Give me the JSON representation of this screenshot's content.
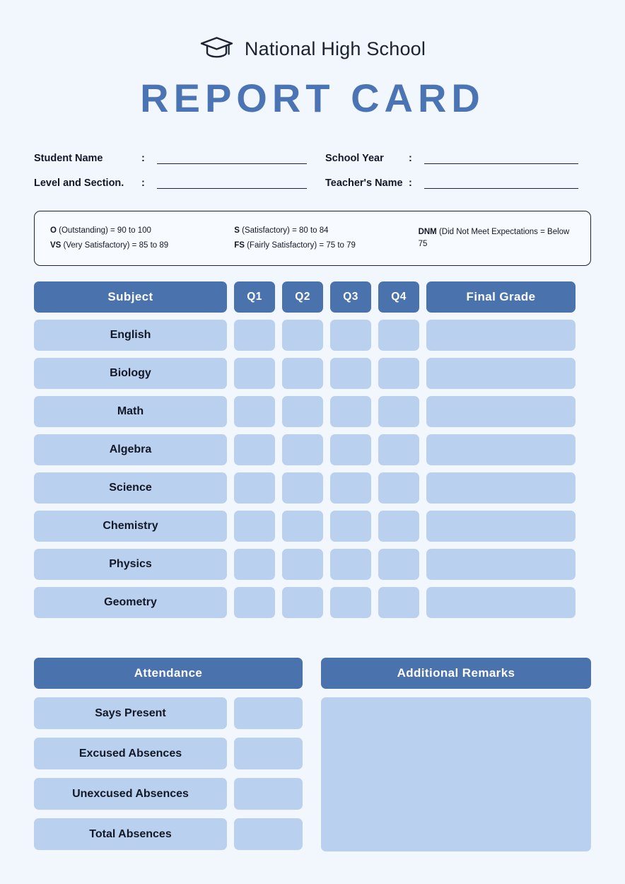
{
  "header": {
    "school_name": "National High School",
    "title": "REPORT CARD",
    "cap_icon": "graduation-cap-icon"
  },
  "info": {
    "colon": ":",
    "fields": [
      {
        "label": "Student Name",
        "value": ""
      },
      {
        "label": "School Year",
        "value": ""
      },
      {
        "label": "Level and Section.",
        "value": ""
      },
      {
        "label": "Teacher's Name",
        "value": ""
      }
    ]
  },
  "legend": {
    "column1": [
      {
        "code": "O",
        "text": " (Outstanding) = 90 to 100"
      },
      {
        "code": "VS",
        "text": " (Very Satisfactory) = 85 to 89"
      }
    ],
    "column2": [
      {
        "code": "S",
        "text": " (Satisfactory) = 80 to 84"
      },
      {
        "code": "FS",
        "text": " (Fairly Satisfactory) = 75 to 79"
      }
    ],
    "column3": [
      {
        "code": "DNM",
        "text": " (Did Not Meet Expectations = Below 75"
      }
    ]
  },
  "grades_table": {
    "headers": {
      "subject": "Subject",
      "q1": "Q1",
      "q2": "Q2",
      "q3": "Q3",
      "q4": "Q4",
      "final": "Final Grade"
    },
    "rows": [
      {
        "subject": "English",
        "q1": "",
        "q2": "",
        "q3": "",
        "q4": "",
        "final": ""
      },
      {
        "subject": "Biology",
        "q1": "",
        "q2": "",
        "q3": "",
        "q4": "",
        "final": ""
      },
      {
        "subject": "Math",
        "q1": "",
        "q2": "",
        "q3": "",
        "q4": "",
        "final": ""
      },
      {
        "subject": "Algebra",
        "q1": "",
        "q2": "",
        "q3": "",
        "q4": "",
        "final": ""
      },
      {
        "subject": "Science",
        "q1": "",
        "q2": "",
        "q3": "",
        "q4": "",
        "final": ""
      },
      {
        "subject": "Chemistry",
        "q1": "",
        "q2": "",
        "q3": "",
        "q4": "",
        "final": ""
      },
      {
        "subject": "Physics",
        "q1": "",
        "q2": "",
        "q3": "",
        "q4": "",
        "final": ""
      },
      {
        "subject": "Geometry",
        "q1": "",
        "q2": "",
        "q3": "",
        "q4": "",
        "final": ""
      }
    ]
  },
  "attendance": {
    "title": "Attendance",
    "rows": [
      {
        "label": "Says Present",
        "value": ""
      },
      {
        "label": "Excused Absences",
        "value": ""
      },
      {
        "label": "Unexcused Absences",
        "value": ""
      },
      {
        "label": "Total Absences",
        "value": ""
      }
    ]
  },
  "remarks": {
    "title": "Additional Remarks",
    "value": ""
  },
  "colors": {
    "page_background": "#f2f6fd",
    "header_blue": "#4a72ac",
    "cell_blue": "#b9d0ef",
    "title_blue": "#4a74b4",
    "text_dark": "#121826"
  }
}
